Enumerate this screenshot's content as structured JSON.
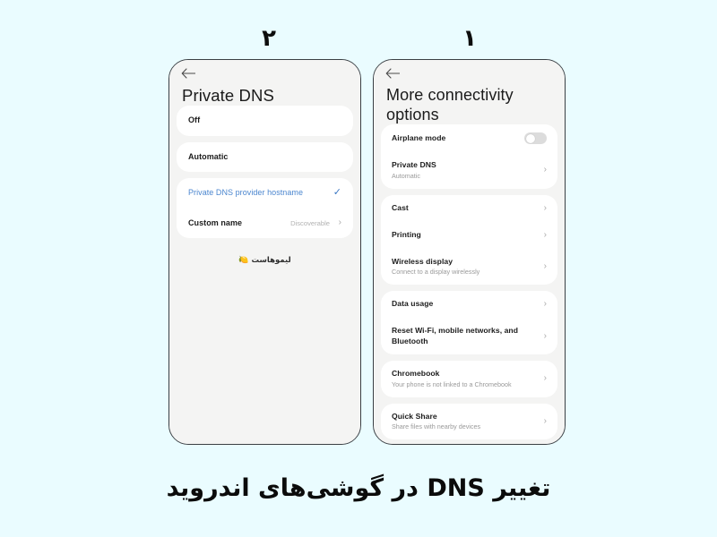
{
  "background_color": "#eafcff",
  "accent_color": "#4b86cf",
  "steps": {
    "left_label": "۲",
    "right_label": "۱"
  },
  "caption": "تغییر DNS در گوشی‌های اندروید",
  "watermark": {
    "emoji": "🍋",
    "text": "لیموهاست"
  },
  "left_phone": {
    "back_icon": "back-arrow-icon",
    "title": "Private DNS",
    "groups": [
      {
        "rows": [
          {
            "title": "Off",
            "subtitle": "",
            "value": "",
            "accessory": "none",
            "selected": false
          }
        ]
      },
      {
        "rows": [
          {
            "title": "Automatic",
            "subtitle": "",
            "value": "",
            "accessory": "none",
            "selected": false
          }
        ]
      },
      {
        "rows": [
          {
            "title": "Private DNS provider hostname",
            "subtitle": "",
            "value": "",
            "accessory": "check",
            "selected": true
          },
          {
            "title": "Custom name",
            "subtitle": "",
            "value": "Discoverable",
            "accessory": "chevron",
            "selected": false
          }
        ]
      }
    ]
  },
  "right_phone": {
    "back_icon": "back-arrow-icon",
    "title": "More connectivity options",
    "groups": [
      {
        "rows": [
          {
            "title": "Airplane mode",
            "subtitle": "",
            "value": "",
            "accessory": "toggle",
            "toggle_on": false
          },
          {
            "title": "Private DNS",
            "subtitle": "Automatic",
            "value": "",
            "accessory": "chevron"
          }
        ]
      },
      {
        "rows": [
          {
            "title": "Cast",
            "subtitle": "",
            "value": "",
            "accessory": "chevron"
          },
          {
            "title": "Printing",
            "subtitle": "",
            "value": "",
            "accessory": "chevron"
          },
          {
            "title": "Wireless display",
            "subtitle": "Connect to a display wirelessly",
            "value": "",
            "accessory": "chevron"
          }
        ]
      },
      {
        "rows": [
          {
            "title": "Data usage",
            "subtitle": "",
            "value": "",
            "accessory": "chevron"
          },
          {
            "title": "Reset Wi-Fi, mobile networks, and Bluetooth",
            "subtitle": "",
            "value": "",
            "accessory": "chevron"
          }
        ]
      },
      {
        "rows": [
          {
            "title": "Chromebook",
            "subtitle": "Your phone is not linked to a Chromebook",
            "value": "",
            "accessory": "chevron"
          }
        ]
      },
      {
        "rows": [
          {
            "title": "Quick Share",
            "subtitle": "Share files with nearby devices",
            "value": "",
            "accessory": "chevron"
          }
        ]
      }
    ]
  },
  "glyphs": {
    "chevron": "›",
    "check": "✓"
  }
}
